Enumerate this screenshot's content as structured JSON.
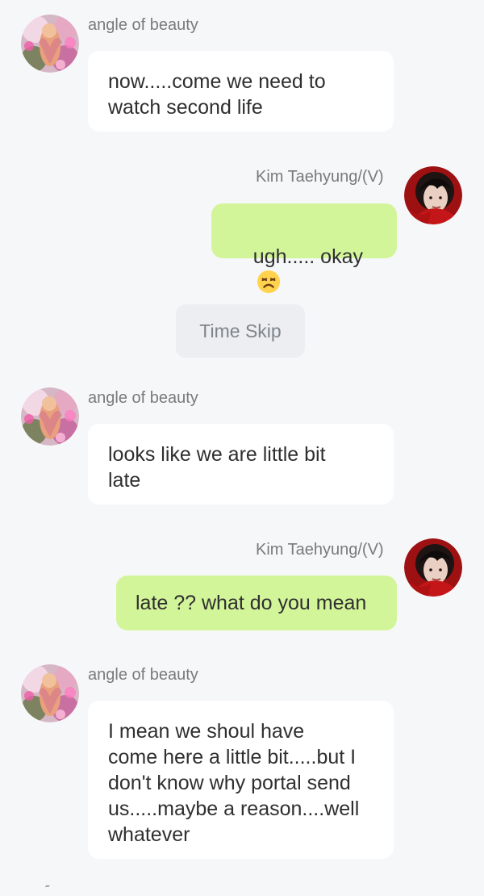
{
  "conversation": {
    "participants": {
      "other": {
        "name": "angle of beauty",
        "avatar_icon": "pink-floral-angel-avatar"
      },
      "self": {
        "name": "Kim Taehyung/(V)",
        "avatar_icon": "kim-taehyung-avatar"
      }
    },
    "messages": [
      {
        "sender": "angle of beauty",
        "text": "now.....come we need to\nwatch second life"
      },
      {
        "sender": "Kim Taehyung/(V)",
        "text": "ugh..... okay",
        "emoji": "tired-face-emoji"
      },
      {
        "system_label": "Time Skip"
      },
      {
        "sender": "angle of beauty",
        "text": "looks like we are little bit\nlate"
      },
      {
        "sender": "Kim Taehyung/(V)",
        "text": "late ?? what do you mean"
      },
      {
        "sender": "angle of beauty",
        "text": "I mean we shoul have\ncome here a little bit.....but I\ndon't know why portal send\nus.....maybe a reason....well\nwhatever"
      }
    ]
  },
  "colors": {
    "background": "#f6f7f9",
    "received_bubble": "#ffffff",
    "sent_bubble": "#d3f59a",
    "name_text": "#7a7a7a",
    "divider_background": "#eceef1"
  }
}
